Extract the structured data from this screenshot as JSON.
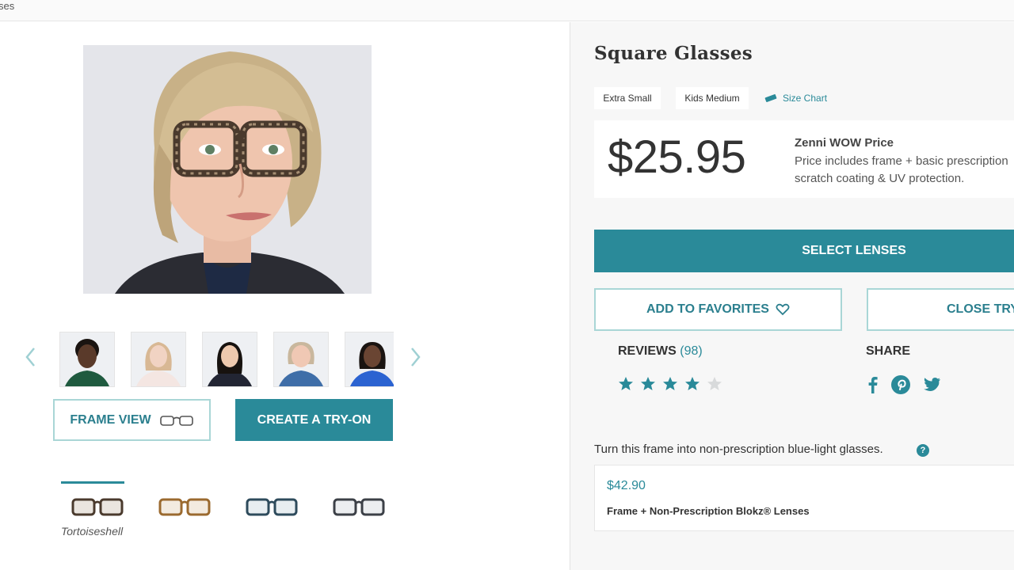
{
  "breadcrumb": {
    "text": "ses"
  },
  "gallery": {
    "main_image_alt": "model wearing tortoiseshell square glasses",
    "prev_icon": "chevron-left-icon",
    "next_icon": "chevron-right-icon",
    "thumbnails": [
      {
        "name": "model-1",
        "skin": "#5a3a2a",
        "hair": "#1a1411",
        "shirt": "#1f5a3f"
      },
      {
        "name": "model-2",
        "skin": "#f1d3c3",
        "hair": "#d8b894",
        "shirt": "#f4e6e2"
      },
      {
        "name": "model-3",
        "skin": "#eec9ae",
        "hair": "#17120f",
        "shirt": "#222533"
      },
      {
        "name": "model-4",
        "skin": "#f0c8b4",
        "hair": "#c9b79d",
        "shirt": "#3f6ea8"
      },
      {
        "name": "model-5",
        "skin": "#6a4533",
        "hair": "#1a1411",
        "shirt": "#2b63d1"
      }
    ]
  },
  "buttons": {
    "frame_view": "FRAME VIEW",
    "create_tryon": "CREATE A TRY-ON",
    "select_lenses": "SELECT LENSES",
    "add_favorites": "ADD TO FAVORITES",
    "close_try": "CLOSE TRY"
  },
  "colors": {
    "selected_name": "Tortoiseshell",
    "swatches": [
      {
        "name": "tortoiseshell",
        "frame": "#4a3a2d",
        "accent": "#a58e73"
      },
      {
        "name": "amber",
        "frame": "#9b6a2f",
        "accent": "#c9995a"
      },
      {
        "name": "blue-gray",
        "frame": "#2e4b5c",
        "accent": "#6d8c9c"
      },
      {
        "name": "gray",
        "frame": "#3c4047",
        "accent": "#7a8088"
      }
    ]
  },
  "product": {
    "title": "Square Glasses",
    "sizes": [
      "Extra Small",
      "Kids Medium"
    ],
    "size_chart": "Size Chart",
    "price": "$25.95",
    "wow_title": "Zenni WOW Price",
    "wow_desc_line1": "Price includes frame + basic prescription",
    "wow_desc_line2": "scratch coating & UV protection."
  },
  "reviews": {
    "label": "REVIEWS",
    "count": "(98)",
    "rating": 4,
    "max": 5
  },
  "share": {
    "label": "SHARE",
    "icons": [
      "facebook-icon",
      "pinterest-icon",
      "twitter-icon"
    ]
  },
  "bluelight": {
    "prompt": "Turn this frame into non-prescription blue-light glasses.",
    "price": "$42.90",
    "description": "Frame + Non-Prescription Blokz® Lenses"
  },
  "theme": {
    "accent": "#2a8a99",
    "accent_light": "#a9d6d6"
  }
}
